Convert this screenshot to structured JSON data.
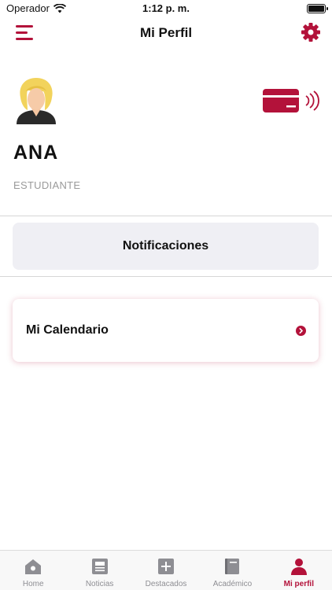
{
  "status_bar": {
    "carrier": "Operador",
    "time": "1:12 p. m."
  },
  "nav": {
    "title": "Mi Perfil"
  },
  "profile": {
    "name": "ANA",
    "role": "ESTUDIANTE"
  },
  "buttons": {
    "notifications": "Notificaciones",
    "calendar": "Mi Calendario"
  },
  "tabs": [
    {
      "label": "Home",
      "icon": "home-icon",
      "active": false
    },
    {
      "label": "Noticias",
      "icon": "news-icon",
      "active": false
    },
    {
      "label": "Destacados",
      "icon": "plus-square-icon",
      "active": false
    },
    {
      "label": "Académico",
      "icon": "book-icon",
      "active": false
    },
    {
      "label": "Mi perfil",
      "icon": "person-icon",
      "active": true
    }
  ],
  "colors": {
    "accent": "#b3123a",
    "inactive_tab": "#8e8e93",
    "card_bg": "#efeff4"
  }
}
